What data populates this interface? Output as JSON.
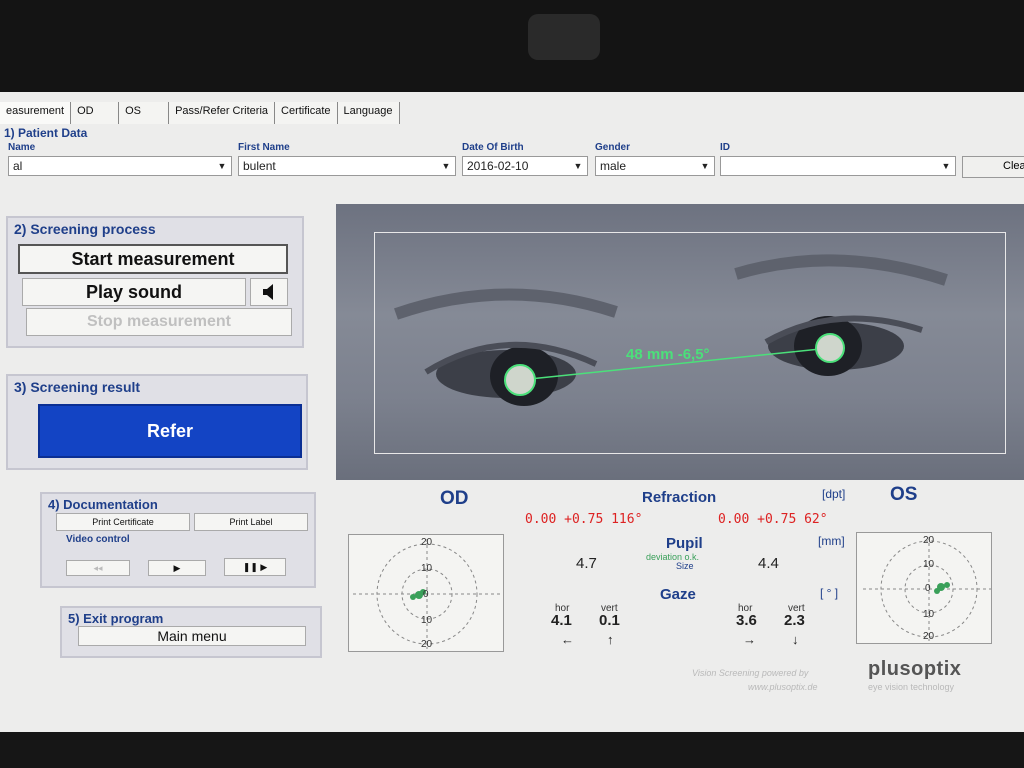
{
  "tabs": [
    {
      "label": "easurement"
    },
    {
      "label": "OD"
    },
    {
      "label": "OS"
    },
    {
      "label": "Pass/Refer Criteria"
    },
    {
      "label": "Certificate"
    },
    {
      "label": "Language"
    }
  ],
  "patient": {
    "section_title": "1) Patient Data",
    "name_label": "Name",
    "name_value": "al",
    "first_name_label": "First Name",
    "first_name_value": "bulent",
    "dob_label": "Date Of Birth",
    "dob_value": "2016-02-10",
    "gender_label": "Gender",
    "gender_value": "male",
    "id_label": "ID",
    "id_value": "",
    "clear_label": "Clea"
  },
  "screening": {
    "title": "2) Screening process",
    "start_label": "Start measurement",
    "play_label": "Play sound",
    "stop_label": "Stop measurement"
  },
  "result": {
    "title": "3) Screening result",
    "value": "Refer"
  },
  "documentation": {
    "title": "4) Documentation",
    "print_certificate": "Print Certificate",
    "print_label": "Print Label",
    "video_control": "Video control"
  },
  "exit": {
    "title": "5) Exit program",
    "main_menu": "Main menu"
  },
  "camera": {
    "measurement": "48 mm   -6,5°"
  },
  "refraction": {
    "od_title": "OD",
    "os_title": "OS",
    "title": "Refraction",
    "unit": "[dpt]",
    "od_value": "0.00 +0.75 116°",
    "os_value": "0.00 +0.75 62°"
  },
  "pupil": {
    "title": "Pupil",
    "unit": "[mm]",
    "note": "deviation o.k.",
    "size_label": "Size",
    "od_value": "4.7",
    "os_value": "4.4"
  },
  "gaze": {
    "title": "Gaze",
    "unit": "[ ° ]",
    "hor_label": "hor",
    "vert_label": "vert",
    "od_hor": "4.1",
    "od_vert": "0.1",
    "os_hor": "3.6",
    "os_vert": "2.3"
  },
  "plot_ticks": [
    "20",
    "10",
    "0",
    "10",
    "20"
  ],
  "footer": {
    "powered": "Vision Screening powered by",
    "url": "www.plusoptix.de",
    "brand": "plusoptix",
    "tagline": "eye vision technology"
  },
  "colors": {
    "accent": "#1f3f8a",
    "refer_button": "#1344c4",
    "refraction_text": "#dd2222",
    "measure_green": "#4be07a"
  }
}
